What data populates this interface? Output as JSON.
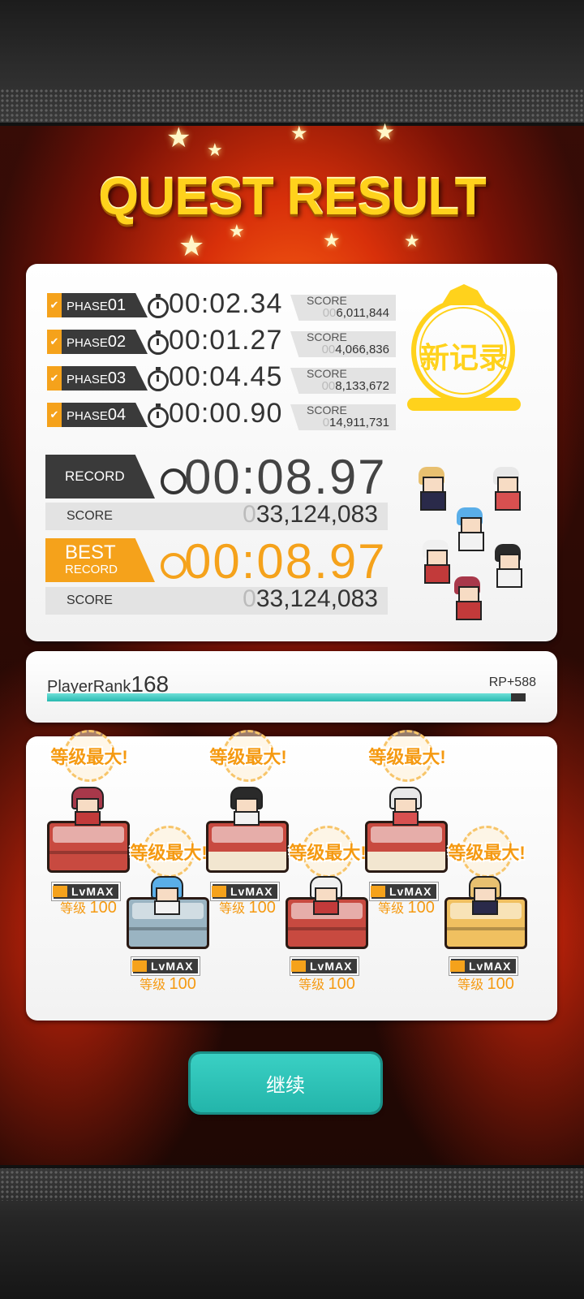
{
  "title": "QUEST RESULT",
  "phases": [
    {
      "label": "PHASE",
      "num": "01",
      "time": "00:02.34",
      "score_label": "SCORE",
      "score_zeros": "00",
      "score": "6,011,844"
    },
    {
      "label": "PHASE",
      "num": "02",
      "time": "00:01.27",
      "score_label": "SCORE",
      "score_zeros": "00",
      "score": "4,066,836"
    },
    {
      "label": "PHASE",
      "num": "03",
      "time": "00:04.45",
      "score_label": "SCORE",
      "score_zeros": "00",
      "score": "8,133,672"
    },
    {
      "label": "PHASE",
      "num": "04",
      "time": "00:00.90",
      "score_label": "SCORE",
      "score_zeros": "0",
      "score": "14,911,731"
    }
  ],
  "record": {
    "label": "RECORD",
    "time": "00:08.97",
    "score_label": "SCORE",
    "score_zeros": "0",
    "score": "33,124,083"
  },
  "best_record": {
    "label_top": "BEST",
    "label_bottom": "RECORD",
    "time": "00:08.97",
    "score_label": "SCORE",
    "score_zeros": "0",
    "score": "33,124,083"
  },
  "new_record_badge": "新记录",
  "player_rank": {
    "label": "PlayerRank",
    "value": "168",
    "rp": "RP+588",
    "progress": 0.97
  },
  "units": [
    {
      "badge": "等级最大!",
      "lv_tag": "LvMAX",
      "lv_label": "等级",
      "lv_value": "100",
      "pedestal": "red",
      "hair": "#a8384a",
      "outfit": "#c23a3a"
    },
    {
      "badge": "等级最大!",
      "lv_tag": "LvMAX",
      "lv_label": "等级",
      "lv_value": "100",
      "pedestal": "blue",
      "hair": "#5aaee8",
      "outfit": "#f2f2f2"
    },
    {
      "badge": "等级最大!",
      "lv_tag": "LvMAX",
      "lv_label": "等级",
      "lv_value": "100",
      "pedestal": "red-cream",
      "hair": "#2a2a2a",
      "outfit": "#f2f2f2"
    },
    {
      "badge": "等级最大!",
      "lv_tag": "LvMAX",
      "lv_label": "等级",
      "lv_value": "100",
      "pedestal": "red",
      "hair": "#f0f0f0",
      "outfit": "#c23a3a"
    },
    {
      "badge": "等级最大!",
      "lv_tag": "LvMAX",
      "lv_label": "等级",
      "lv_value": "100",
      "pedestal": "red-cream",
      "hair": "#e8e8e8",
      "outfit": "#d85050"
    },
    {
      "badge": "等级最大!",
      "lv_tag": "LvMAX",
      "lv_label": "等级",
      "lv_value": "100",
      "pedestal": "gold",
      "hair": "#e8c070",
      "outfit": "#2a2a4a"
    }
  ],
  "continue_label": "继续",
  "colors": {
    "accent_orange": "#f5a21b",
    "teal": "#2dc2b8",
    "dark_tag": "#3a3a3a",
    "gold": "#ffd21c"
  }
}
